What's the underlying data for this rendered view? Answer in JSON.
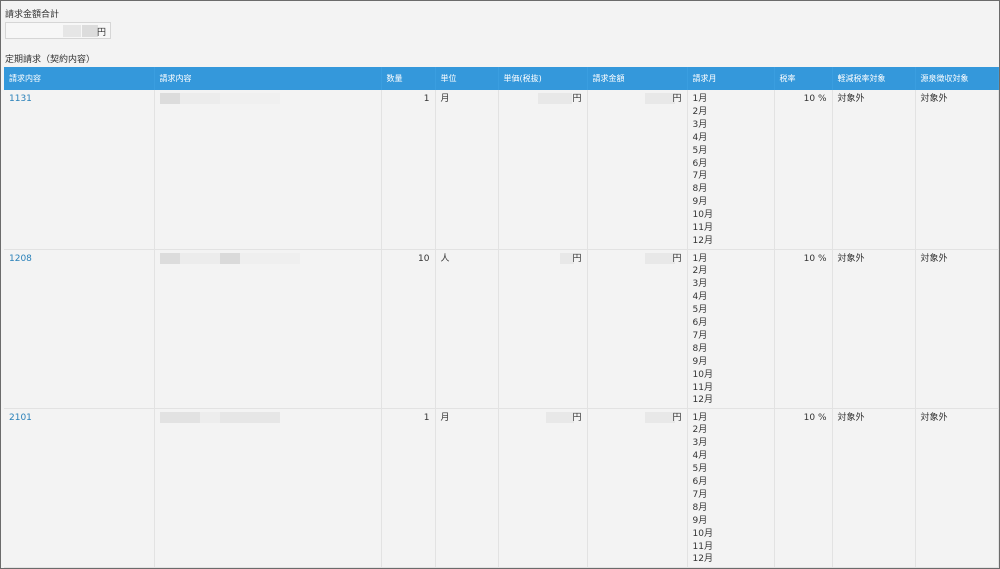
{
  "total": {
    "label": "請求金額合計",
    "currency": "円"
  },
  "section_title": "定期請求（契約内容）",
  "columns": [
    "請求内容",
    "請求内容",
    "数量",
    "単位",
    "単価(税抜)",
    "請求金額",
    "請求月",
    "税率",
    "軽減税率対象",
    "源泉徴収対象"
  ],
  "rows": [
    {
      "code": "1131",
      "qty": "1",
      "unit": "月",
      "price_currency": "円",
      "amount_currency": "円",
      "months": [
        "1月",
        "2月",
        "3月",
        "4月",
        "5月",
        "6月",
        "7月",
        "8月",
        "9月",
        "10月",
        "11月",
        "12月"
      ],
      "tax": "10 %",
      "reduced": "対象外",
      "withholding": "対象外"
    },
    {
      "code": "1208",
      "qty": "10",
      "unit": "人",
      "price_currency": "円",
      "amount_currency": "円",
      "months": [
        "1月",
        "2月",
        "3月",
        "4月",
        "5月",
        "6月",
        "7月",
        "8月",
        "9月",
        "10月",
        "11月",
        "12月"
      ],
      "tax": "10 %",
      "reduced": "対象外",
      "withholding": "対象外"
    },
    {
      "code": "2101",
      "qty": "1",
      "unit": "月",
      "price_currency": "円",
      "amount_currency": "円",
      "months": [
        "1月",
        "2月",
        "3月",
        "4月",
        "5月",
        "6月",
        "7月",
        "8月",
        "9月",
        "10月",
        "11月",
        "12月"
      ],
      "tax": "10 %",
      "reduced": "対象外",
      "withholding": "対象外"
    }
  ]
}
